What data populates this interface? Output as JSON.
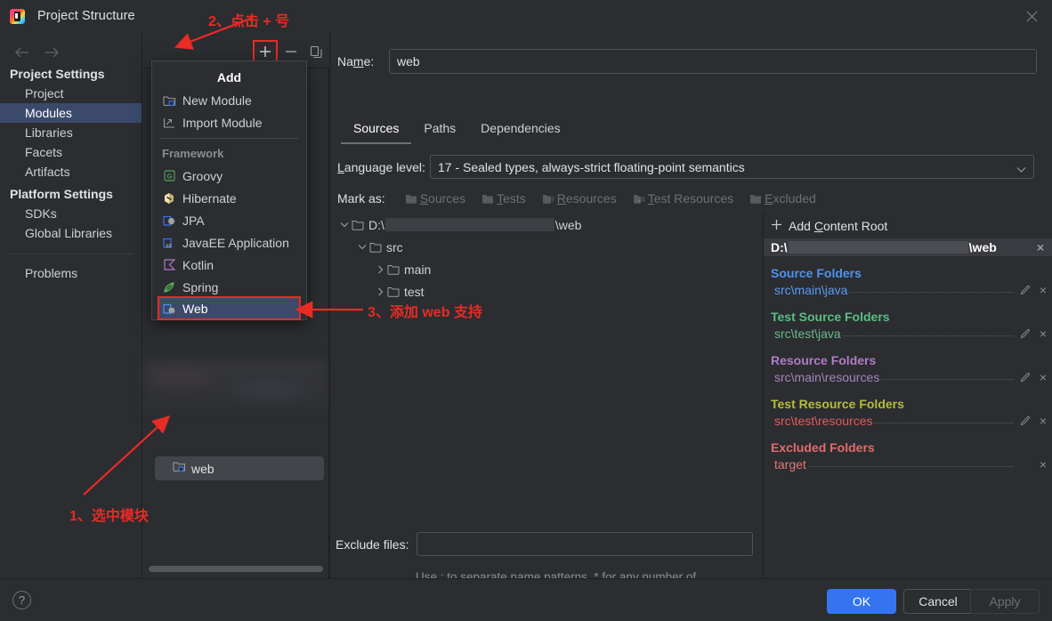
{
  "window": {
    "title": "Project Structure",
    "app_icon": "intellij-idea-icon",
    "close_icon": "close-icon"
  },
  "nav": {
    "back_icon": "arrow-left-icon",
    "forward_icon": "arrow-right-icon",
    "groups": [
      {
        "title": "Project Settings",
        "items": [
          {
            "label": "Project",
            "selected": false
          },
          {
            "label": "Modules",
            "selected": true
          },
          {
            "label": "Libraries",
            "selected": false
          },
          {
            "label": "Facets",
            "selected": false
          },
          {
            "label": "Artifacts",
            "selected": false
          }
        ]
      },
      {
        "title": "Platform Settings",
        "items": [
          {
            "label": "SDKs",
            "selected": false
          },
          {
            "label": "Global Libraries",
            "selected": false
          }
        ]
      }
    ],
    "problems": "Problems"
  },
  "module_panel": {
    "toolbar": {
      "add_icon": "plus-icon",
      "remove_icon": "minus-icon",
      "copy_icon": "copy-icon",
      "add_highlight_color": "#e82b25"
    },
    "modules": [
      {
        "label": "web",
        "icon": "module-folder-icon",
        "selected": true
      }
    ],
    "scrollbar": "horizontal-scrollbar"
  },
  "add_popup": {
    "title": "Add",
    "items": [
      {
        "label": "New Module",
        "icon": "new-module-icon"
      },
      {
        "label": "Import Module",
        "icon": "import-module-icon"
      }
    ],
    "section_title": "Framework",
    "frameworks": [
      {
        "label": "Groovy",
        "icon": "groovy-icon",
        "selected": false
      },
      {
        "label": "Hibernate",
        "icon": "hibernate-icon",
        "selected": false
      },
      {
        "label": "JPA",
        "icon": "jpa-icon",
        "selected": false
      },
      {
        "label": "JavaEE Application",
        "icon": "javaee-icon",
        "selected": false
      },
      {
        "label": "Kotlin",
        "icon": "kotlin-icon",
        "selected": false
      },
      {
        "label": "Spring",
        "icon": "spring-icon",
        "selected": false
      },
      {
        "label": "Web",
        "icon": "web-icon",
        "selected": true
      }
    ]
  },
  "detail": {
    "name_label_pre": "Na",
    "name_label_accel": "m",
    "name_label_post": "e:",
    "name_value": "web",
    "tabs": [
      {
        "label": "Sources",
        "active": true
      },
      {
        "label": "Paths",
        "active": false
      },
      {
        "label": "Dependencies",
        "active": false
      }
    ],
    "language_level_label_accel": "L",
    "language_level_label_rest": "anguage level:",
    "language_level_value": "17 - Sealed types, always-strict floating-point semantics",
    "dropdown_icon": "chevron-down-icon",
    "mark_as_label": "Mark as:",
    "mark_as_buttons": [
      {
        "pre": "",
        "accel": "S",
        "post": "ources",
        "icon": "sources-folder-icon"
      },
      {
        "pre": "",
        "accel": "T",
        "post": "ests",
        "icon": "tests-folder-icon"
      },
      {
        "pre": "",
        "accel": "R",
        "post": "esources",
        "icon": "resources-folder-icon"
      },
      {
        "pre": "",
        "accel": "T",
        "post": "est Resources",
        "icon": "test-resources-folder-icon"
      },
      {
        "pre": "",
        "accel": "E",
        "post": "xcluded",
        "icon": "excluded-folder-icon"
      }
    ],
    "tree": [
      {
        "label_prefix": "D:\\",
        "label_suffix": "\\web",
        "redacted": true,
        "indent": 0,
        "expanded": true,
        "icon": "folder-icon"
      },
      {
        "label_prefix": "src",
        "label_suffix": "",
        "redacted": false,
        "indent": 1,
        "expanded": true,
        "icon": "folder-icon"
      },
      {
        "label_prefix": "main",
        "label_suffix": "",
        "redacted": false,
        "indent": 2,
        "expanded": false,
        "icon": "folder-icon"
      },
      {
        "label_prefix": "test",
        "label_suffix": "",
        "redacted": false,
        "indent": 2,
        "expanded": false,
        "icon": "folder-icon"
      }
    ],
    "exclude_files_label": "Exclude files:",
    "exclude_files_value": "",
    "exclude_hint": "Use ; to separate name patterns, * for any number of symbols, ? for one."
  },
  "content_roots": {
    "add_label_pre": "Add ",
    "add_label_accel": "C",
    "add_label_post": "ontent Root",
    "add_icon": "plus-icon",
    "root_prefix": "D:\\",
    "root_suffix": "\\web",
    "remove_icon": "close-icon",
    "groups": [
      {
        "title": "Source Folders",
        "color": "#4d94f0",
        "path_color": "#5b9bf3",
        "entries": [
          {
            "path": "src\\main\\java",
            "editable": true,
            "removable": true
          }
        ]
      },
      {
        "title": "Test Source Folders",
        "color": "#5bbd83",
        "path_color": "#6cb98b",
        "entries": [
          {
            "path": "src\\test\\java",
            "editable": true,
            "removable": true
          }
        ]
      },
      {
        "title": "Resource Folders",
        "color": "#b07cc6",
        "path_color": "#a884bb",
        "entries": [
          {
            "path": "src\\main\\resources",
            "editable": true,
            "removable": true
          }
        ]
      },
      {
        "title": "Test Resource Folders",
        "color": "#b5bd3a",
        "path_color": "#e05c5c",
        "entries": [
          {
            "path": "src\\test\\resources",
            "editable": true,
            "removable": true
          }
        ]
      },
      {
        "title": "Excluded Folders",
        "color": "#e66a6a",
        "path_color": "#e07878",
        "entries": [
          {
            "path": "target",
            "editable": false,
            "removable": true
          }
        ]
      }
    ]
  },
  "footer": {
    "help_label": "?",
    "ok_label": "OK",
    "cancel_label": "Cancel",
    "apply_label": "Apply",
    "ok_color": "#3574f0"
  },
  "annotations": {
    "color": "#e82b25",
    "step1": "1、选中模块",
    "step2": "2、点击 + 号",
    "step3": "3、添加 web 支持"
  }
}
